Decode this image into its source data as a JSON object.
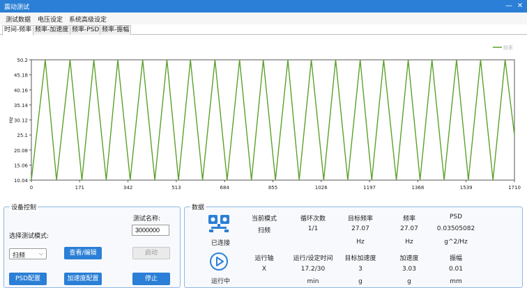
{
  "window": {
    "title": "震动测试",
    "minimize": "—",
    "close": "✕"
  },
  "menu": [
    "测试数据",
    "电压设定",
    "系统高级设定"
  ],
  "tabs": [
    "时间-频率",
    "频率-加速度",
    "频率-PSD",
    "频率-振幅"
  ],
  "chart_data": {
    "type": "line",
    "ylabel": "Hz",
    "xlim": [
      0,
      1710
    ],
    "ylim": [
      10.04,
      50.2
    ],
    "x_ticks": [
      "0",
      "171",
      "342",
      "513",
      "684",
      "855",
      "1026",
      "1197",
      "1368",
      "1539",
      "1710"
    ],
    "y_ticks": [
      "50.2",
      "45.18",
      "40.16",
      "35.14",
      "30.12",
      "25.1",
      "20.08",
      "15.06",
      "10.04"
    ],
    "legend": {
      "label": "频率",
      "position": "top-right"
    },
    "series": [
      {
        "name": "频率",
        "color": "#5aa12a",
        "x": [
          0,
          49,
          89,
          137,
          179,
          221,
          265,
          306,
          350,
          394,
          437,
          480,
          521,
          563,
          606,
          650,
          693,
          737,
          779,
          821,
          864,
          908,
          948,
          991,
          1035,
          1077,
          1120,
          1164,
          1205,
          1247,
          1292,
          1334,
          1376,
          1418,
          1461,
          1505,
          1547,
          1590,
          1634,
          1677,
          1710
        ],
        "y": [
          10.04,
          50.2,
          10.04,
          50.2,
          10.04,
          50.2,
          10.04,
          50.2,
          10.04,
          50.2,
          10.04,
          50.2,
          10.04,
          50.2,
          10.04,
          50.2,
          10.04,
          50.2,
          10.04,
          50.2,
          10.04,
          50.2,
          10.04,
          50.2,
          10.04,
          50.2,
          10.04,
          50.2,
          10.04,
          50.2,
          10.04,
          50.2,
          10.04,
          50.2,
          10.04,
          50.2,
          10.04,
          50.2,
          10.04,
          50.2,
          25.1
        ]
      }
    ]
  },
  "device_control": {
    "title": "设备控制",
    "test_name_label": "测试名称:",
    "test_name_value": "3000000",
    "mode_label": "选择测试模式:",
    "mode_selected": "扫频",
    "view_edit": "查看/编辑",
    "start": "启动",
    "psd_config": "PSD配置",
    "accel_config": "加速度配置",
    "stop": "停止"
  },
  "data_panel": {
    "title": "数据",
    "connected_label": "已连接",
    "running_label": "运行中",
    "row1_headers": [
      "当前模式",
      "循环次数",
      "目标频率",
      "频率",
      "PSD"
    ],
    "row1_values": [
      "扫频",
      "1/1",
      "27.07",
      "27.07",
      "0.03505082"
    ],
    "row1_units": [
      "",
      "",
      "Hz",
      "Hz",
      "g^2/Hz"
    ],
    "row2_headers": [
      "运行轴",
      "运行/设定时间",
      "目标加速度",
      "加速度",
      "振幅"
    ],
    "row2_values": [
      "X",
      "17.2/30",
      "3",
      "3.03",
      "0.01"
    ],
    "row2_units": [
      "",
      "min",
      "g",
      "g",
      "mm"
    ]
  }
}
